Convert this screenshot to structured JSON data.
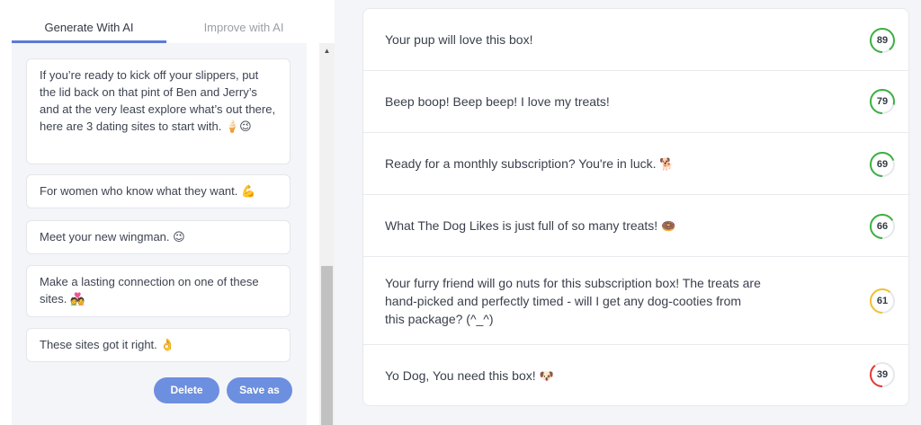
{
  "tabs": [
    {
      "label": "Generate With AI",
      "active": true
    },
    {
      "label": "Improve with AI",
      "active": false
    }
  ],
  "cards": [
    {
      "text": "If you’re ready to kick off your slippers, put the lid back on that pint of Ben and Jerry’s and at the very least explore what’s out there, here are 3 dating sites to start with.",
      "emoji": "🍦😉"
    },
    {
      "text": "For women who know what they want.",
      "emoji": "💪"
    },
    {
      "text": "Meet your new wingman.",
      "emoji": "😉"
    },
    {
      "text": "Make a lasting connection on one of these sites.",
      "emoji": "💑"
    },
    {
      "text": "These sites got it right.",
      "emoji": "👌"
    }
  ],
  "buttons": {
    "delete": "Delete",
    "save_as": "Save as"
  },
  "results": [
    {
      "text": "Your pup will love this box!",
      "emoji": "",
      "score": 89,
      "color": "#3cb043"
    },
    {
      "text": "Beep boop! Beep beep! I love my treats!",
      "emoji": "",
      "score": 79,
      "color": "#3cb043"
    },
    {
      "text": "Ready for a monthly subscription? You're in luck.",
      "emoji": "🐕",
      "score": 69,
      "color": "#3cb043"
    },
    {
      "text": "What The Dog Likes is just full of so many treats!",
      "emoji": "🍩",
      "score": 66,
      "color": "#3cb043"
    },
    {
      "text": "Your furry friend will go nuts for this subscription box! The treats are hand-picked and perfectly timed - will I get any dog-cooties from this package? (^_^)",
      "emoji": "",
      "score": 61,
      "color": "#f2c12e"
    },
    {
      "text": "Yo Dog, You need this box!",
      "emoji": "🐶",
      "score": 39,
      "color": "#e53935"
    }
  ]
}
